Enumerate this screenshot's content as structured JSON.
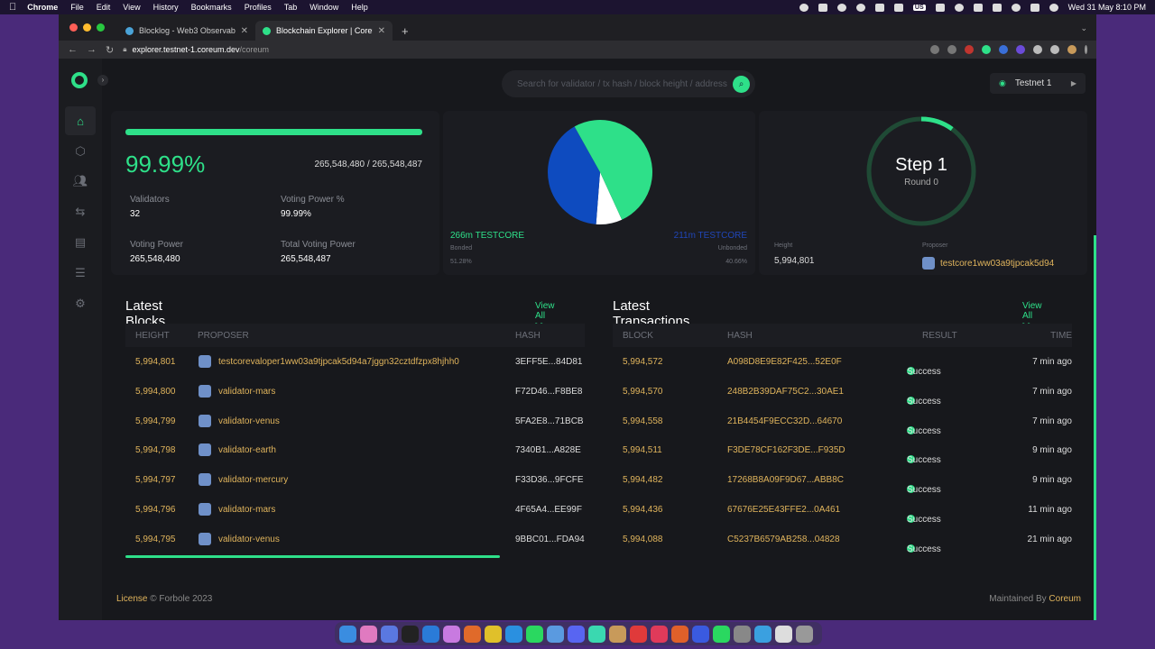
{
  "menubar": {
    "app": "Chrome",
    "items": [
      "File",
      "Edit",
      "View",
      "History",
      "Bookmarks",
      "Profiles",
      "Tab",
      "Window",
      "Help"
    ],
    "datetime": "Wed 31 May  8:10 PM",
    "keyboard": "US"
  },
  "browser": {
    "tabs": [
      {
        "title": "Blocklog - Web3 Observability",
        "active": false
      },
      {
        "title": "Blockchain Explorer | Coreum",
        "active": true
      }
    ],
    "url_domain": "explorer.testnet-1.coreum.dev",
    "url_path": "/coreum"
  },
  "header": {
    "search_placeholder": "Search for validator / tx hash / block height / address",
    "network": "Testnet 1"
  },
  "consensus": {
    "percent": "99.99%",
    "percent_value": 0.9999,
    "ratio": "265,548,480 / 265,548,487",
    "validators_label": "Validators",
    "validators": "32",
    "voting_power_pct_label": "Voting Power %",
    "voting_power_pct": "99.99%",
    "voting_power_label": "Voting Power",
    "voting_power": "265,548,480",
    "total_voting_power_label": "Total Voting Power",
    "total_voting_power": "265,548,487"
  },
  "tokens": {
    "bonded_amount": "266m TESTCORE",
    "bonded_label": "Bonded",
    "bonded_pct": "51.28%",
    "unbonded_amount": "211m TESTCORE",
    "unbonded_label": "Unbonded",
    "unbonded_pct": "40.66%",
    "colors": {
      "bonded": "#2ee089",
      "unbonded": "#0e4bbf",
      "other": "#ffffff"
    }
  },
  "step": {
    "step": "Step 1",
    "round": "Round 0",
    "progress": 0.1,
    "height_label": "Height",
    "height": "5,994,801",
    "proposer_label": "Proposer",
    "proposer": "testcore1ww03a9tjpcak5d94"
  },
  "latest_blocks": {
    "title": "Latest Blocks",
    "view_all": "View All >>",
    "columns": [
      "HEIGHT",
      "PROPOSER",
      "HASH"
    ],
    "rows": [
      {
        "height": "5,994,801",
        "proposer": "testcorevaloper1ww03a9tjpcak5d94a7jggn32cztdfzpx8hjhh0",
        "hash": "3EFF5E...84D81"
      },
      {
        "height": "5,994,800",
        "proposer": "validator-mars",
        "hash": "F72D46...F8BE8"
      },
      {
        "height": "5,994,799",
        "proposer": "validator-venus",
        "hash": "5FA2E8...71BCB"
      },
      {
        "height": "5,994,798",
        "proposer": "validator-earth",
        "hash": "7340B1...A828E"
      },
      {
        "height": "5,994,797",
        "proposer": "validator-mercury",
        "hash": "F33D36...9FCFE"
      },
      {
        "height": "5,994,796",
        "proposer": "validator-mars",
        "hash": "4F65A4...EE99F"
      },
      {
        "height": "5,994,795",
        "proposer": "validator-venus",
        "hash": "9BBC01...FDA94"
      }
    ]
  },
  "latest_transactions": {
    "title": "Latest Transactions",
    "view_all": "View All >>",
    "columns": [
      "BLOCK",
      "HASH",
      "RESULT",
      "TIME"
    ],
    "rows": [
      {
        "block": "5,994,572",
        "hash": "A098D8E9E82F425...52E0F",
        "result": "Success",
        "time": "7 min ago"
      },
      {
        "block": "5,994,570",
        "hash": "248B2B39DAF75C2...30AE1",
        "result": "Success",
        "time": "7 min ago"
      },
      {
        "block": "5,994,558",
        "hash": "21B4454F9ECC32D...64670",
        "result": "Success",
        "time": "7 min ago"
      },
      {
        "block": "5,994,511",
        "hash": "F3DE78CF162F3DE...F935D",
        "result": "Success",
        "time": "9 min ago"
      },
      {
        "block": "5,994,482",
        "hash": "17268B8A09F9D67...ABB8C",
        "result": "Success",
        "time": "9 min ago"
      },
      {
        "block": "5,994,436",
        "hash": "67676E25E43FFE2...0A461",
        "result": "Success",
        "time": "11 min ago"
      },
      {
        "block": "5,994,088",
        "hash": "C5237B6579AB258...04828",
        "result": "Success",
        "time": "21 min ago"
      }
    ]
  },
  "footer": {
    "license": "License",
    "copyright": "© Forbole 2023",
    "maintained": "Maintained By",
    "maintainer": "Coreum"
  }
}
